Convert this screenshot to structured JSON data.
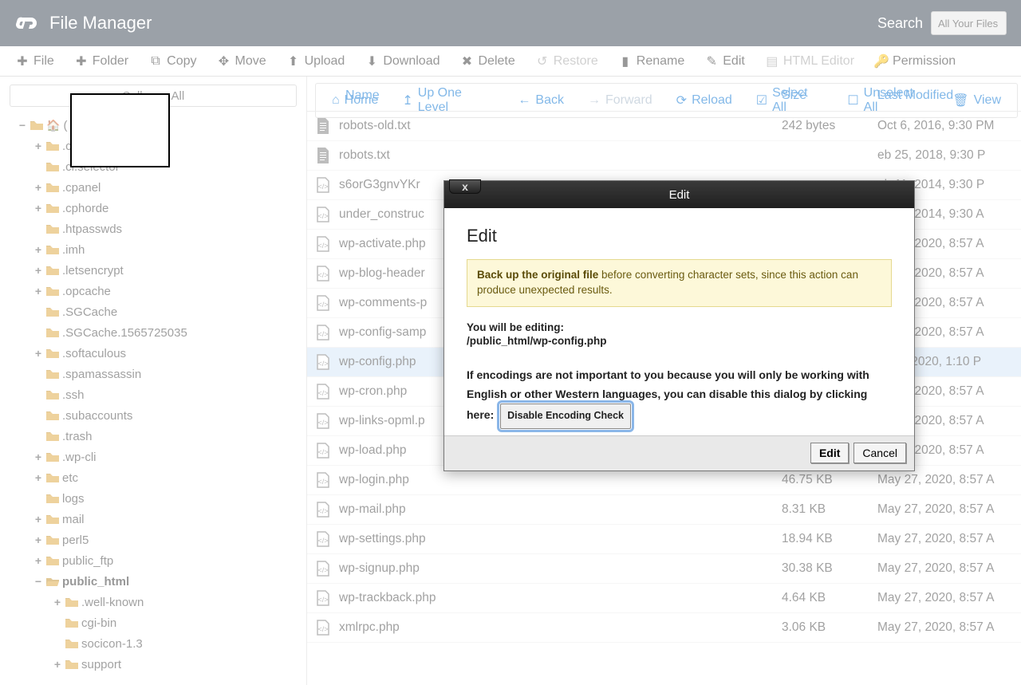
{
  "header": {
    "title": "File Manager",
    "search_label": "Search",
    "search_placeholder": "All Your Files"
  },
  "toolbar": {
    "file": "File",
    "folder": "Folder",
    "copy": "Copy",
    "move": "Move",
    "upload": "Upload",
    "download": "Download",
    "delete": "Delete",
    "restore": "Restore",
    "rename": "Rename",
    "edit": "Edit",
    "html_editor": "HTML Editor",
    "permissions": "Permission"
  },
  "sec_toolbar": {
    "home": "Home",
    "up": "Up One Level",
    "back": "Back",
    "forward": "Forward",
    "reload": "Reload",
    "select_all": "Select All",
    "unselect_all": "Unselect All",
    "view": "View"
  },
  "sidebar": {
    "collapse": "Collapse All",
    "root_label": "(",
    "items": [
      {
        "exp": "+",
        "label": ".c",
        "indent": 1
      },
      {
        "exp": "",
        "label": ".ci.selector",
        "indent": 1
      },
      {
        "exp": "+",
        "label": ".cpanel",
        "indent": 1
      },
      {
        "exp": "+",
        "label": ".cphorde",
        "indent": 1
      },
      {
        "exp": "",
        "label": ".htpasswds",
        "indent": 1
      },
      {
        "exp": "+",
        "label": ".imh",
        "indent": 1
      },
      {
        "exp": "+",
        "label": ".letsencrypt",
        "indent": 1
      },
      {
        "exp": "+",
        "label": ".opcache",
        "indent": 1
      },
      {
        "exp": "",
        "label": ".SGCache",
        "indent": 1
      },
      {
        "exp": "",
        "label": ".SGCache.1565725035",
        "indent": 1
      },
      {
        "exp": "+",
        "label": ".softaculous",
        "indent": 1
      },
      {
        "exp": "",
        "label": ".spamassassin",
        "indent": 1
      },
      {
        "exp": "",
        "label": ".ssh",
        "indent": 1
      },
      {
        "exp": "",
        "label": ".subaccounts",
        "indent": 1
      },
      {
        "exp": "",
        "label": ".trash",
        "indent": 1
      },
      {
        "exp": "+",
        "label": ".wp-cli",
        "indent": 1
      },
      {
        "exp": "+",
        "label": "etc",
        "indent": 1
      },
      {
        "exp": "",
        "label": "logs",
        "indent": 1
      },
      {
        "exp": "+",
        "label": "mail",
        "indent": 1
      },
      {
        "exp": "+",
        "label": "perl5",
        "indent": 1
      },
      {
        "exp": "+",
        "label": "public_ftp",
        "indent": 1
      },
      {
        "exp": "−",
        "label": "public_html",
        "indent": 1,
        "sel": true,
        "open": true
      },
      {
        "exp": "+",
        "label": ".well-known",
        "indent": 2
      },
      {
        "exp": "",
        "label": "cgi-bin",
        "indent": 2
      },
      {
        "exp": "",
        "label": "socicon-1.3",
        "indent": 2
      },
      {
        "exp": "+",
        "label": "support",
        "indent": 2
      }
    ]
  },
  "table": {
    "head": {
      "name": "Name",
      "size": "Size",
      "mod": "Last Modified"
    },
    "rows": [
      {
        "icon": "text",
        "name": "robots-old.txt",
        "size": "242 bytes",
        "mod": "Oct 6, 2016, 9:30 PM"
      },
      {
        "icon": "text",
        "name": "robots.txt",
        "size": "",
        "mod": "eb 25, 2018, 9:30 P"
      },
      {
        "icon": "code",
        "name": "s6orG3gnvYKr",
        "size": "",
        "mod": "eb 11, 2014, 9:30 P"
      },
      {
        "icon": "code",
        "name": "under_construc",
        "size": "",
        "mod": "ay 27, 2014, 9:30 A"
      },
      {
        "icon": "code",
        "name": "wp-activate.php",
        "size": "",
        "mod": "ay 27, 2020, 8:57 A"
      },
      {
        "icon": "code",
        "name": "wp-blog-header",
        "size": "",
        "mod": "ay 27, 2020, 8:57 A"
      },
      {
        "icon": "code",
        "name": "wp-comments-p",
        "size": "",
        "mod": "ay 27, 2020, 8:57 A"
      },
      {
        "icon": "code",
        "name": "wp-config-samp",
        "size": "",
        "mod": "ay 27, 2020, 8:57 A"
      },
      {
        "icon": "code",
        "name": "wp-config.php",
        "size": "",
        "mod": "ig 14, 2020, 1:10 P",
        "sel": true
      },
      {
        "icon": "code",
        "name": "wp-cron.php",
        "size": "",
        "mod": "ay 27, 2020, 8:57 A"
      },
      {
        "icon": "code",
        "name": "wp-links-opml.p",
        "size": "",
        "mod": "ay 27, 2020, 8:57 A"
      },
      {
        "icon": "code",
        "name": "wp-load.php",
        "size": "",
        "mod": "ay 27, 2020, 8:57 A"
      },
      {
        "icon": "code",
        "name": "wp-login.php",
        "size": "46.75 KB",
        "mod": "May 27, 2020, 8:57 A"
      },
      {
        "icon": "code",
        "name": "wp-mail.php",
        "size": "8.31 KB",
        "mod": "May 27, 2020, 8:57 A"
      },
      {
        "icon": "code",
        "name": "wp-settings.php",
        "size": "18.94 KB",
        "mod": "May 27, 2020, 8:57 A"
      },
      {
        "icon": "code",
        "name": "wp-signup.php",
        "size": "30.38 KB",
        "mod": "May 27, 2020, 8:57 A"
      },
      {
        "icon": "code",
        "name": "wp-trackback.php",
        "size": "4.64 KB",
        "mod": "May 27, 2020, 8:57 A"
      },
      {
        "icon": "code",
        "name": "xmlrpc.php",
        "size": "3.06 KB",
        "mod": "May 27, 2020, 8:57 A"
      }
    ]
  },
  "modal": {
    "title": "Edit",
    "close": "x",
    "heading": "Edit",
    "warn_strong": "Back up the original file",
    "warn_rest": " before converting character sets, since this action can produce unexpected results.",
    "editing_label": "You will be editing:",
    "editing_path": "/public_html/wp-config.php",
    "enc_text1": "If encodings are not important to you because you will only be working with English or other Western languages, you can disable this dialog by clicking here:",
    "disable_btn": "Disable Encoding Check",
    "footer_edit": "Edit",
    "footer_cancel": "Cancel"
  }
}
